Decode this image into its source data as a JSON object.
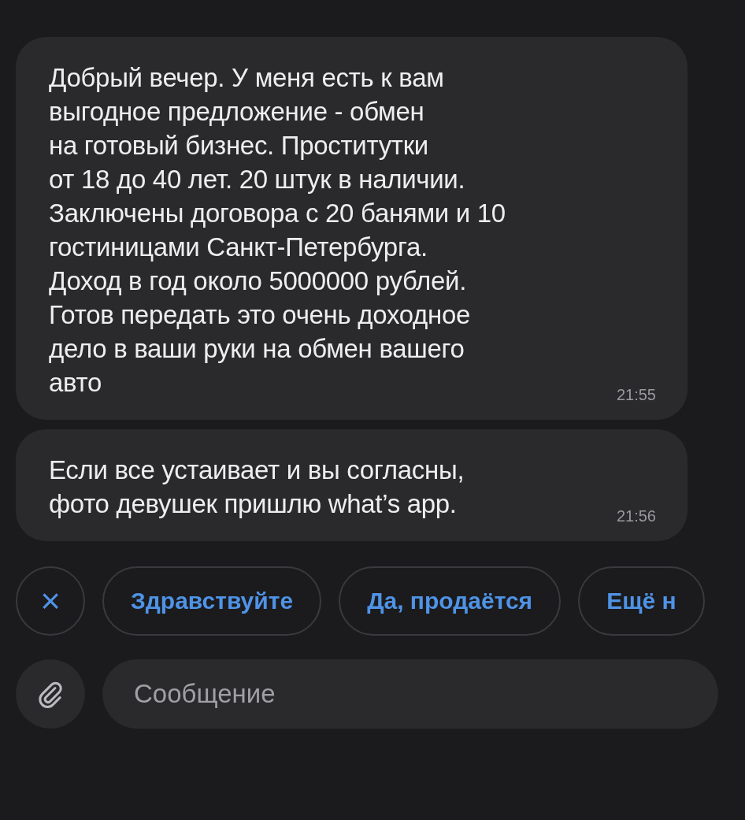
{
  "messages": [
    {
      "text": "Добрый вечер. У меня есть к вам\nвыгодное предложение - обмен\nна готовый бизнес. Проститутки\nот 18 до 40 лет. 20 штук в наличии.\nЗаключены договора с 20 банями и 10\nгостиницами Санкт-Петербурга.\nДоход в год около 5000000 рублей.\nГотов передать это очень доходное\nдело в ваши руки на обмен вашего\nавто",
      "time": "21:55"
    },
    {
      "text": "Если все устаивает и вы согласны,\nфото девушек пришлю what’s app.",
      "time": "21:56"
    }
  ],
  "quick_replies": [
    {
      "kind": "close",
      "label": "×"
    },
    {
      "kind": "reply",
      "label": "Здравствуйте"
    },
    {
      "kind": "reply",
      "label": "Да, продаётся"
    },
    {
      "kind": "reply",
      "label": "Ещё н"
    }
  ],
  "composer": {
    "placeholder": "Сообщение"
  }
}
